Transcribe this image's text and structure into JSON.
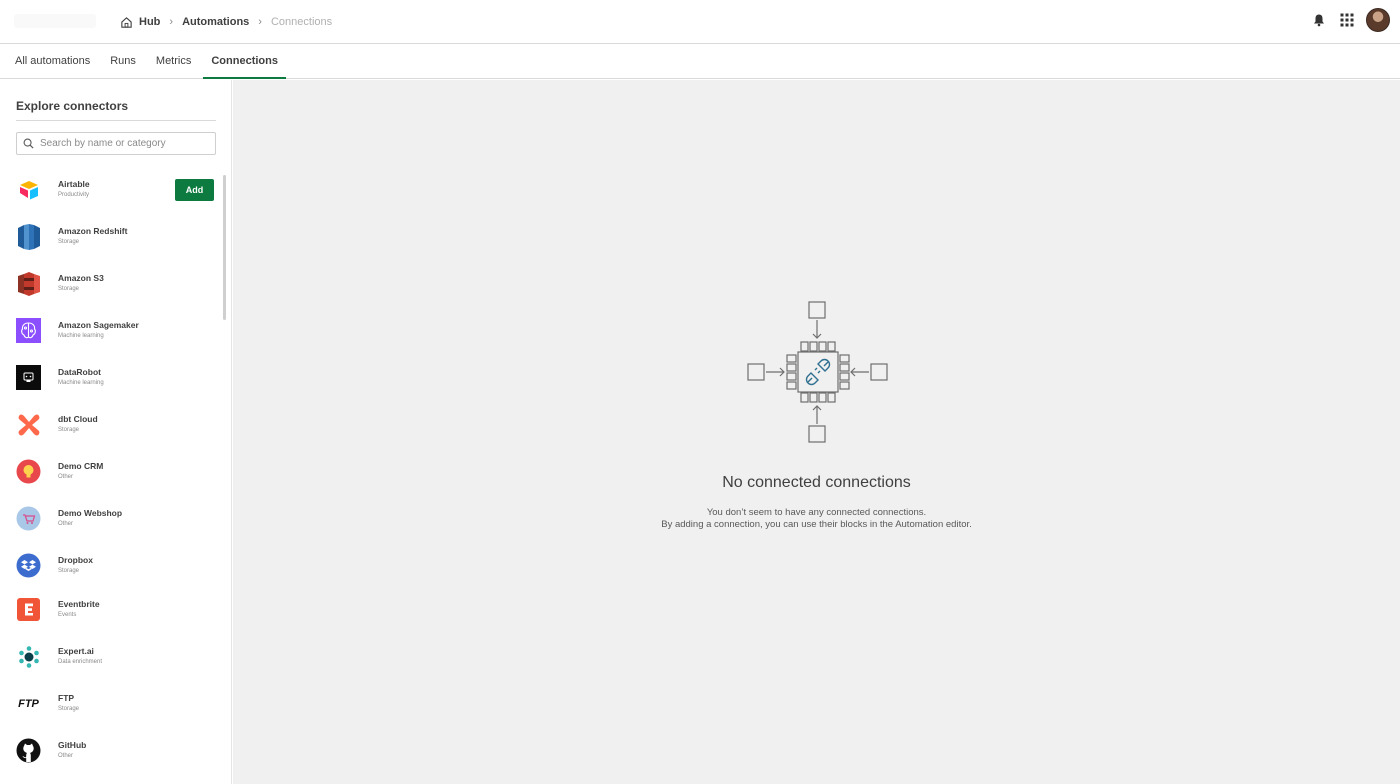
{
  "breadcrumb": {
    "hub": "Hub",
    "automations": "Automations",
    "current": "Connections"
  },
  "tabs": [
    {
      "label": "All automations",
      "active": false
    },
    {
      "label": "Runs",
      "active": false
    },
    {
      "label": "Metrics",
      "active": false
    },
    {
      "label": "Connections",
      "active": true
    }
  ],
  "sidebar": {
    "title": "Explore connectors",
    "search_placeholder": "Search by name or category",
    "add_label": "Add",
    "items": [
      {
        "name": "Airtable",
        "category": "Productivity",
        "icon": "airtable-icon"
      },
      {
        "name": "Amazon Redshift",
        "category": "Storage",
        "icon": "amazon-redshift-icon"
      },
      {
        "name": "Amazon S3",
        "category": "Storage",
        "icon": "amazon-s3-icon"
      },
      {
        "name": "Amazon Sagemaker",
        "category": "Machine learning",
        "icon": "amazon-sagemaker-icon"
      },
      {
        "name": "DataRobot",
        "category": "Machine learning",
        "icon": "datarobot-icon"
      },
      {
        "name": "dbt Cloud",
        "category": "Storage",
        "icon": "dbt-cloud-icon"
      },
      {
        "name": "Demo CRM",
        "category": "Other",
        "icon": "demo-crm-icon"
      },
      {
        "name": "Demo Webshop",
        "category": "Other",
        "icon": "demo-webshop-icon"
      },
      {
        "name": "Dropbox",
        "category": "Storage",
        "icon": "dropbox-icon"
      },
      {
        "name": "Eventbrite",
        "category": "Events",
        "icon": "eventbrite-icon"
      },
      {
        "name": "Expert.ai",
        "category": "Data enrichment",
        "icon": "expert-ai-icon"
      },
      {
        "name": "FTP",
        "category": "Storage",
        "icon": "ftp-icon"
      },
      {
        "name": "GitHub",
        "category": "Other",
        "icon": "github-icon"
      }
    ]
  },
  "empty_state": {
    "title": "No connected connections",
    "line1": "You don’t seem to have any connected connections.",
    "line2": "By adding a connection, you can use their blocks in the Automation editor."
  },
  "colors": {
    "accent": "#0d7a3f",
    "main_bg": "#f0f0f0"
  }
}
